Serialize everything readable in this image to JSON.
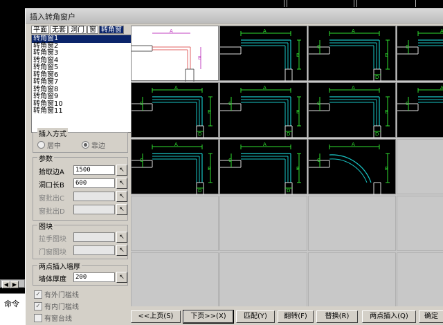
{
  "dialog": {
    "title": "插入转角窗户"
  },
  "tabs": [
    {
      "label": "平面"
    },
    {
      "label": "无套"
    },
    {
      "label": "洞门"
    },
    {
      "label": "窗"
    },
    {
      "label": "转角窗"
    }
  ],
  "window_list": [
    "转角窗1",
    "转角窗2",
    "转角窗3",
    "转角窗4",
    "转角窗5",
    "转角窗6",
    "转角窗7",
    "转角窗8",
    "转角窗9",
    "转角窗10",
    "转角窗11"
  ],
  "insert_mode": {
    "legend": "插入方式",
    "option_center": "居中",
    "option_edge": "靠边",
    "selected": "靠边"
  },
  "params": {
    "legend": "参数",
    "pick_edge_label": "拾取边A",
    "pick_edge_value": "1500",
    "opening_len_label": "洞口长B",
    "opening_len_value": "600",
    "sill_c_label": "窗批出C",
    "sill_c_value": "",
    "sill_d_label": "窗批出D",
    "sill_d_value": ""
  },
  "blocks": {
    "legend": "图块",
    "handle_label": "拉手图块",
    "handle_value": "",
    "door_label": "门窗图块",
    "door_value": ""
  },
  "two_point": {
    "legend": "两点插入墙厚",
    "wall_label": "墙体厚度",
    "wall_value": "200"
  },
  "checks": {
    "outer_sill": "有外门槛线",
    "inner_sill": "有内门槛线",
    "window_sill": "有窗台线"
  },
  "left_panel": {
    "cmd_label": "命令"
  },
  "grid": {
    "dim_labels": [
      "A",
      "B",
      "C",
      "D"
    ]
  },
  "buttons": {
    "prev": "<<上页(S)",
    "next": "下页>>(X)",
    "match": "匹配(Y)",
    "flip": "翻转(F)",
    "replace": "替换(R)",
    "two_point": "两点插入(Q)",
    "ok": "确定"
  },
  "colors": {
    "cyan": "#19c6c6",
    "green": "#30e030",
    "select_blue": "#0a246a",
    "magenta": "#c040c0"
  }
}
